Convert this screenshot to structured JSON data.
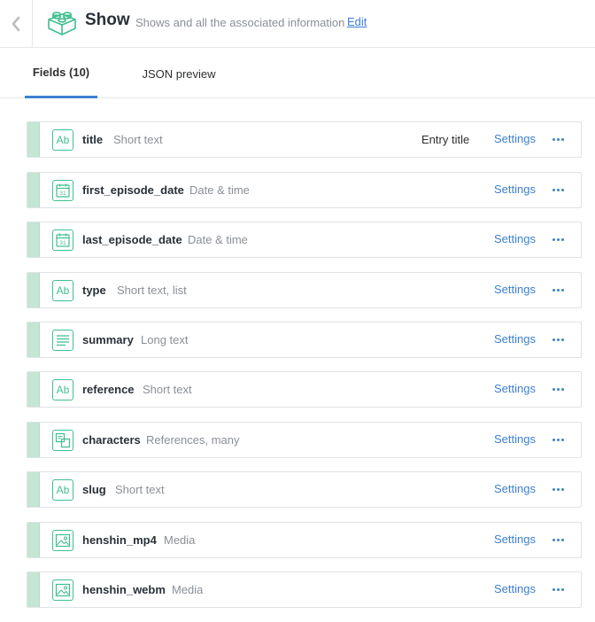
{
  "header": {
    "title": "Show",
    "description": "Shows and all the associated information",
    "edit_label": "Edit",
    "back_icon": "chevron-left-icon",
    "content_type_icon": "lego-brick-icon"
  },
  "tabs": [
    {
      "label": "Fields (10)",
      "active": true
    },
    {
      "label": "JSON preview",
      "active": false
    }
  ],
  "colors": {
    "accent": "#3c80cf",
    "field_icon": "#3fbf8e",
    "drag_handle": "#c4e6d4"
  },
  "fields": [
    {
      "name": "title",
      "type": "Short text",
      "icon": "text-ab-icon",
      "entry_title": "Entry title",
      "settings_label": "Settings"
    },
    {
      "name": "first_episode_date",
      "type": "Date & time",
      "icon": "calendar-icon",
      "settings_label": "Settings"
    },
    {
      "name": "last_episode_date",
      "type": "Date & time",
      "icon": "calendar-icon",
      "settings_label": "Settings"
    },
    {
      "name": "type",
      "type": "Short text, list",
      "icon": "text-ab-icon",
      "settings_label": "Settings"
    },
    {
      "name": "summary",
      "type": "Long text",
      "icon": "long-text-icon",
      "settings_label": "Settings"
    },
    {
      "name": "reference",
      "type": "Short text",
      "icon": "text-ab-icon",
      "settings_label": "Settings"
    },
    {
      "name": "characters",
      "type": "References, many",
      "icon": "references-icon",
      "settings_label": "Settings"
    },
    {
      "name": "slug",
      "type": "Short text",
      "icon": "text-ab-icon",
      "settings_label": "Settings"
    },
    {
      "name": "henshin_mp4",
      "type": "Media",
      "icon": "media-image-icon",
      "settings_label": "Settings"
    },
    {
      "name": "henshin_webm",
      "type": "Media",
      "icon": "media-image-icon",
      "settings_label": "Settings"
    }
  ]
}
